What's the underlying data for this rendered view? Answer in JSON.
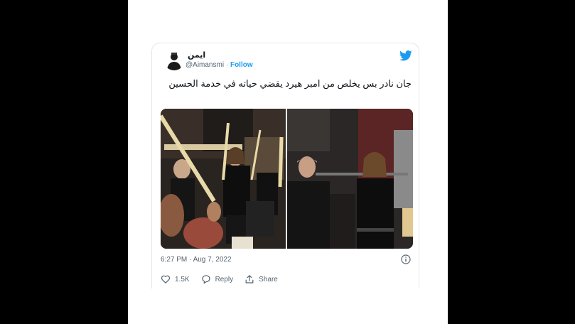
{
  "tweet": {
    "display_name": "ايمن",
    "handle": "@Aimansmi",
    "separator": "·",
    "follow_label": "Follow",
    "text": "جان نادر بس يخلص من امبر هيرد يقضي حياته في خدمة الحسين",
    "timestamp": "6:27 PM · Aug 7, 2022",
    "actions": {
      "like_count": "1.5K",
      "reply_label": "Reply",
      "share_label": "Share"
    }
  },
  "icons": {
    "brand": "twitter-bird-icon",
    "info": "info-icon",
    "like": "heart-icon",
    "reply": "reply-bubble-icon",
    "share": "share-upload-icon"
  },
  "colors": {
    "accent": "#1d9bf0",
    "text": "#0f1419",
    "muted": "#536471",
    "background": "#000000"
  }
}
